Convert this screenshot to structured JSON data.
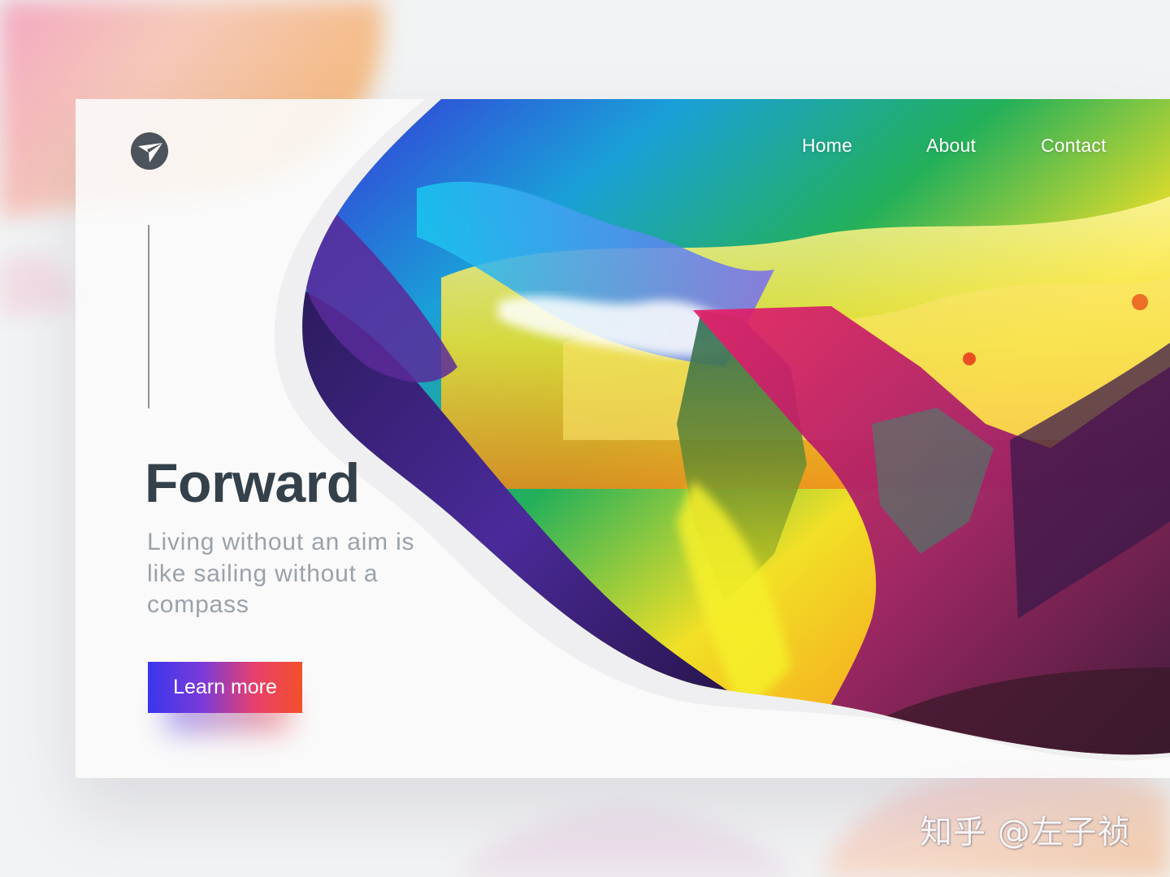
{
  "header": {
    "logo_icon": "paper-plane-icon",
    "nav": [
      {
        "label": "Home"
      },
      {
        "label": "About"
      },
      {
        "label": "Contact"
      }
    ]
  },
  "hero": {
    "title": "Forward",
    "tagline": "Living without an aim is like sailing without a compass",
    "cta_label": "Learn more"
  },
  "watermark": "知乎 @左子祯",
  "colors": {
    "title": "#34404a",
    "tagline": "#9aa2aa",
    "divider": "#8c949c",
    "cta_gradient_start": "#3a35ee",
    "cta_gradient_end": "#f3502c",
    "nav_text": "#ffffff"
  }
}
